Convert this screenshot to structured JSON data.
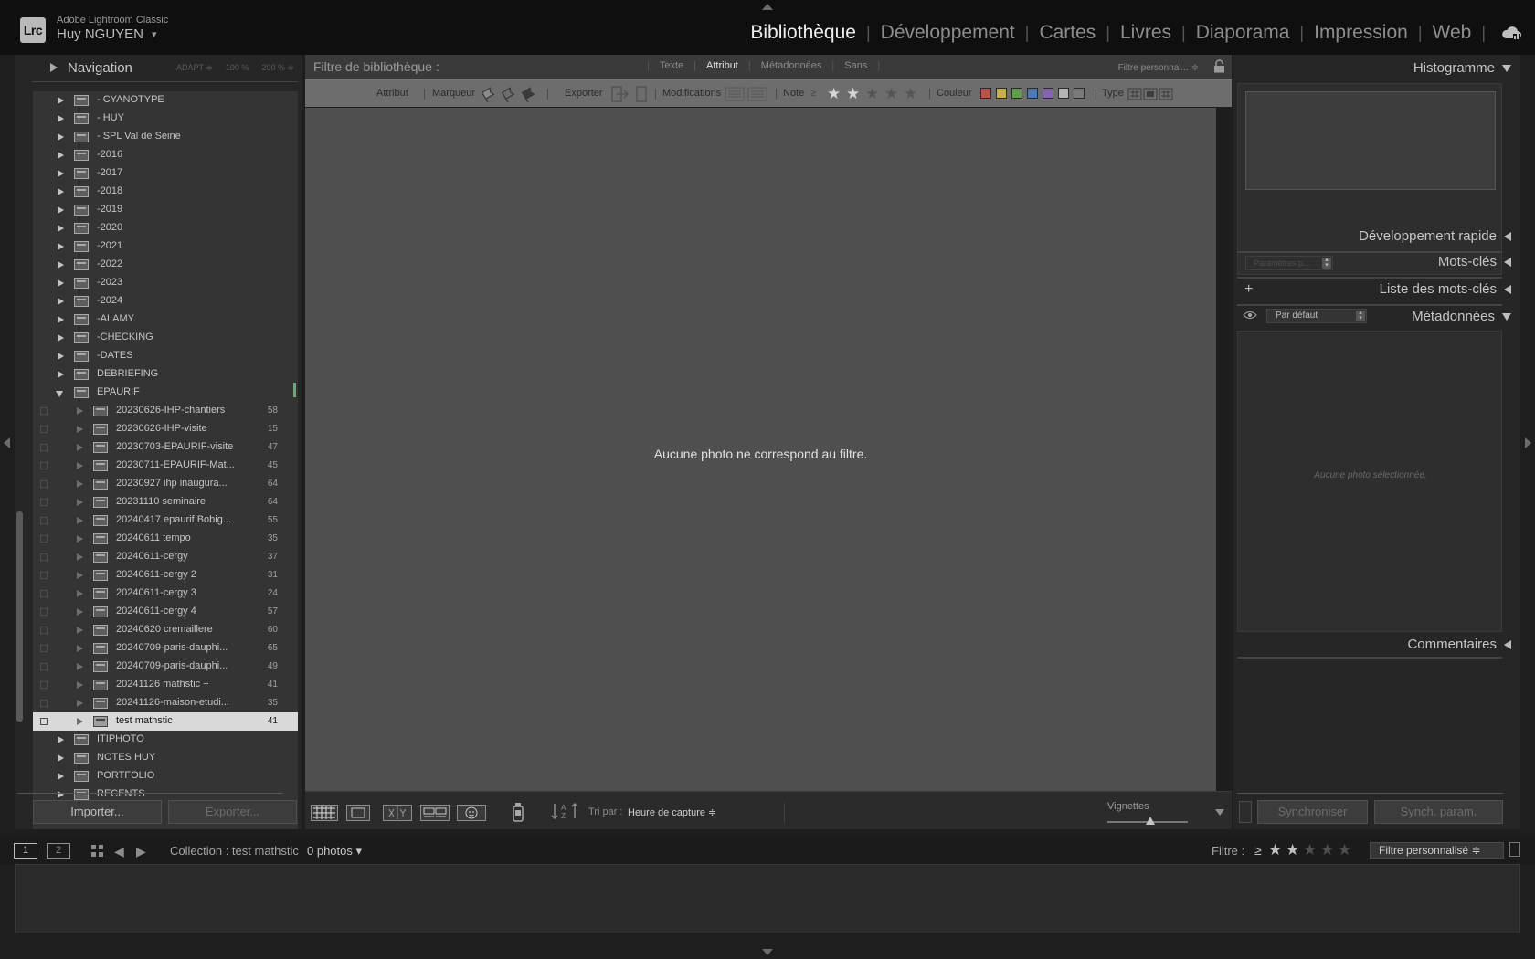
{
  "app": {
    "logo": "Lrc",
    "name": "Adobe Lightroom Classic",
    "user": "Huy NGUYEN",
    "user_caret": "▾"
  },
  "modules": [
    {
      "label": "Bibliothèque",
      "active": true
    },
    {
      "label": "Développement"
    },
    {
      "label": "Cartes"
    },
    {
      "label": "Livres"
    },
    {
      "label": "Diaporama"
    },
    {
      "label": "Impression"
    },
    {
      "label": "Web"
    }
  ],
  "left": {
    "navigator": {
      "title": "Navigation",
      "zooms": [
        "ADAPT ≑",
        "100 %",
        "200 % ≑"
      ]
    },
    "folders": [
      {
        "label": "- CYANOTYPE"
      },
      {
        "label": "- HUY"
      },
      {
        "label": "- SPL Val de Seine"
      },
      {
        "label": "-2016"
      },
      {
        "label": "-2017"
      },
      {
        "label": "-2018"
      },
      {
        "label": "-2019"
      },
      {
        "label": "-2020"
      },
      {
        "label": "-2021"
      },
      {
        "label": "-2022"
      },
      {
        "label": "-2023"
      },
      {
        "label": "-2024"
      },
      {
        "label": "-ALAMY"
      },
      {
        "label": "-CHECKING"
      },
      {
        "label": "-DATES"
      },
      {
        "label": "DEBRIEFING"
      },
      {
        "label": "EPAURIF",
        "expanded": true
      },
      {
        "label": "20230626-IHP-chantiers",
        "count": "58",
        "child": true
      },
      {
        "label": "20230626-IHP-visite",
        "count": "15",
        "child": true
      },
      {
        "label": "20230703-EPAURIF-visite",
        "count": "47",
        "child": true
      },
      {
        "label": "20230711-EPAURIF-Mat...",
        "count": "45",
        "child": true
      },
      {
        "label": "20230927 ihp inaugura...",
        "count": "64",
        "child": true
      },
      {
        "label": "20231110 seminaire",
        "count": "64",
        "child": true
      },
      {
        "label": "20240417 epaurif Bobig...",
        "count": "55",
        "child": true
      },
      {
        "label": "20240611 tempo",
        "count": "35",
        "child": true
      },
      {
        "label": "20240611-cergy",
        "count": "37",
        "child": true
      },
      {
        "label": "20240611-cergy 2",
        "count": "31",
        "child": true
      },
      {
        "label": "20240611-cergy 3",
        "count": "24",
        "child": true
      },
      {
        "label": "20240611-cergy 4",
        "count": "57",
        "child": true
      },
      {
        "label": "20240620 cremaillere",
        "count": "60",
        "child": true
      },
      {
        "label": "20240709-paris-dauphi...",
        "count": "65",
        "child": true
      },
      {
        "label": "20240709-paris-dauphi...",
        "count": "49",
        "child": true
      },
      {
        "label": "20241126 mathstic +",
        "count": "41",
        "child": true
      },
      {
        "label": "20241126-maison-etudi...",
        "count": "35",
        "child": true
      },
      {
        "label": "test mathstic",
        "count": "41",
        "child": true,
        "selected": true
      },
      {
        "label": "ITIPHOTO"
      },
      {
        "label": "NOTES HUY"
      },
      {
        "label": "PORTFOLIO"
      },
      {
        "label": "RECENTS"
      }
    ],
    "import_label": "Importer...",
    "export_label": "Exporter..."
  },
  "filter_bar": {
    "title": "Filtre de bibliothèque :",
    "tabs": [
      {
        "label": "Texte"
      },
      {
        "label": "Attribut",
        "active": true
      },
      {
        "label": "Métadonnées"
      },
      {
        "label": "Sans"
      }
    ],
    "preset": "Filtre personnal... ≑"
  },
  "attr_bar": {
    "attribut": "Attribut",
    "marqueur": "Marqueur",
    "exporter": "Exporter",
    "modifications": "Modifications",
    "note": "Note",
    "note_op": "≥",
    "rating": 2,
    "couleur": "Couleur",
    "colors": [
      "#c0504d",
      "#c9b23a",
      "#5e9e4c",
      "#4c79b8",
      "#8763b4",
      "#b6b6b6",
      "#7a7a7a"
    ],
    "type": "Type"
  },
  "grid": {
    "empty_message": "Aucune photo ne correspond au filtre."
  },
  "toolbar": {
    "sort_label": "Tri par :",
    "sort_value": "Heure de capture ≑",
    "thumbnails_label": "Vignettes",
    "thumbnail_size": 0.5
  },
  "right": {
    "histogram": "Histogramme",
    "quick_develop": "Développement rapide",
    "quick_develop_preset": "Paramètres p...",
    "keywords": "Mots-clés",
    "keyword_list": "Liste des mots-clés",
    "metadata": "Métadonnées",
    "metadata_preset": "Par défaut",
    "metadata_empty": "Aucune photo sélectionnée.",
    "comments": "Commentaires",
    "sync_label": "Synchroniser",
    "sync_params_label": "Synch. param."
  },
  "filmstrip": {
    "monitor1": "1",
    "monitor2": "2",
    "collection": "Collection : test mathstic",
    "photos": "0 photos ▾",
    "filter_label": "Filtre :",
    "filter_op": "≥",
    "rating": 2,
    "filter_preset": "Filtre personnalisé ≑"
  }
}
